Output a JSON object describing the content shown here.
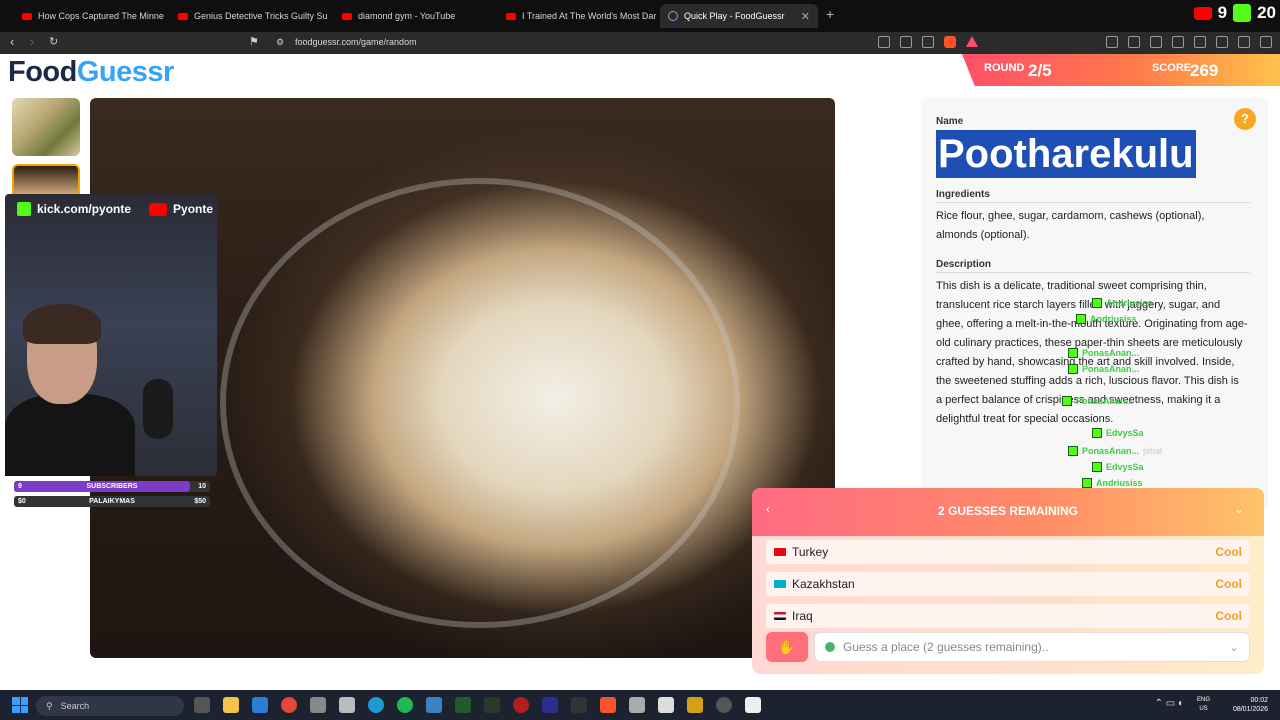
{
  "browser": {
    "tabs": [
      {
        "title": "How Cops Captured The Minnesota I",
        "kind": "youtube",
        "active": false
      },
      {
        "title": "Genius Detective Tricks Guilty Suspe",
        "kind": "youtube",
        "active": false
      },
      {
        "title": "diamond gym - YouTube",
        "kind": "youtube",
        "active": false
      },
      {
        "title": "I Trained At The World's Most Dange",
        "kind": "youtube",
        "active": false
      },
      {
        "title": "Quick Play - FoodGuessr | FoodG",
        "kind": "site",
        "active": true
      }
    ],
    "url": "foodguessr.com/game/random",
    "tray": {
      "yt_count": "9",
      "kick_count": "20"
    }
  },
  "app": {
    "logo_food": "Food",
    "logo_guessr": "Guessr",
    "round_label": "ROUND",
    "round_value": "2/5",
    "score_label": "SCORE",
    "score_value": "269"
  },
  "overlay": {
    "kick_handle": "kick.com/pyonte",
    "yt_handle": "Pyonte",
    "goal1": {
      "left": "9",
      "label": "SUBSCRIBERS",
      "right": "10",
      "fraction": 0.9
    },
    "goal2": {
      "left": "$0",
      "label": "PALAIKYMAS",
      "right": "$50",
      "fraction": 0.0
    }
  },
  "info": {
    "name_label": "Name",
    "dish_name": "Pootharekulu",
    "ingredients_label": "Ingredients",
    "ingredients": "Rice flour, ghee, sugar, cardamom, cashews (optional), almonds (optional).",
    "description_label": "Description",
    "description": "This dish is a delicate, traditional sweet comprising thin, translucent rice starch layers filled with jaggery, sugar, and ghee, offering a melt-in-the-mouth texture. Originating from age-old culinary practices, these paper-thin sheets are meticulously crafted by hand, showcasing the art and skill involved. Inside, the sweetened stuffing adds a rich, luscious flavor. This dish is a perfect balance of crispiness and sweetness, making it a delightful treat for special occasions.",
    "hint_glyph": "?"
  },
  "chat": [
    {
      "name": "Andriusiss",
      "msg": ""
    },
    {
      "name": "Andriusiss",
      "msg": ""
    },
    {
      "name": "PonasAnan...",
      "msg": ""
    },
    {
      "name": "PonasAnan...",
      "msg": ""
    },
    {
      "name": "PonasAnan...",
      "msg": ""
    },
    {
      "name": "EdvysSa",
      "msg": ""
    },
    {
      "name": "EdvysSa",
      "msg": ""
    },
    {
      "name": "PonasAnan...",
      "msg": "pibal"
    },
    {
      "name": "EdvysSa",
      "msg": ""
    },
    {
      "name": "Andriusiss",
      "msg": ""
    }
  ],
  "guess": {
    "title": "2 GUESSES REMAINING",
    "rows": [
      {
        "country": "Turkey",
        "result": "Cool",
        "flag": "#e30a17"
      },
      {
        "country": "Kazakhstan",
        "result": "Cool",
        "flag": "#00afca"
      },
      {
        "country": "Iraq",
        "result": "Cool",
        "flag": "#ce1126"
      }
    ],
    "placeholder": "Guess a place (2 guesses remaining).."
  },
  "taskbar": {
    "search": "Search",
    "lang1": "ENG",
    "lang2": "US",
    "time": "00:02",
    "date": "08/01/2026"
  }
}
